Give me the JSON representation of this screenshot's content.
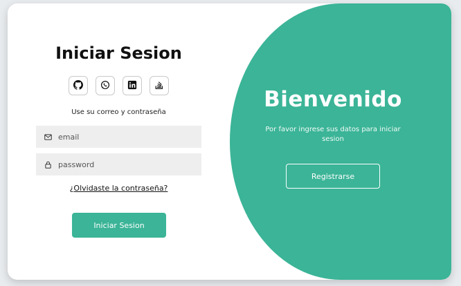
{
  "login": {
    "title": "Iniciar Sesion",
    "social_icons": [
      "github-icon",
      "whatsapp-icon",
      "linkedin-icon",
      "stackoverflow-icon"
    ],
    "hint": "Use su correo y contraseña",
    "email_placeholder": "email",
    "password_placeholder": "password",
    "forgot_link": "¿Olvidaste la contraseña?",
    "submit_label": "Iniciar Sesion"
  },
  "welcome": {
    "title": "Bienvenido",
    "text": "Por favor ingrese sus datos para iniciar sesion",
    "register_label": "Registrarse"
  },
  "colors": {
    "accent": "#3bb497",
    "background": "#e9ecef",
    "field_bg": "#eeeeee"
  }
}
